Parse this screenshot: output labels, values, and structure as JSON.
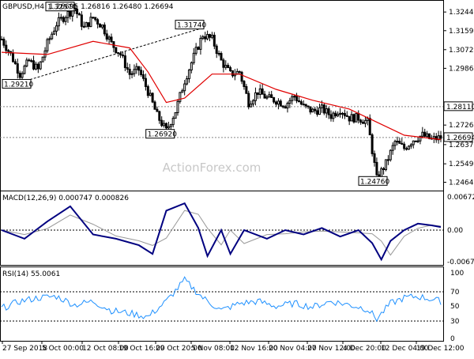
{
  "header": {
    "symbol": "GBPUSD,H4",
    "ohlc": "1.26695 1.26816 1.26480 1.26694"
  },
  "watermark": "ActionForex.com",
  "price_pane": {
    "y_ticks": [
      "1.32445",
      "1.31590",
      "1.30720",
      "1.29865",
      "1.28110",
      "1.27265",
      "1.26370",
      "1.25490",
      "1.24645"
    ],
    "current_price": "1.26694",
    "resistance_level": "1.28110",
    "swing_labels": [
      {
        "text": "1.32570",
        "price": 1.3257,
        "x_label": "5 Oct 00:00"
      },
      {
        "text": "1.31740",
        "price": 1.3174,
        "x_label": "5 Nov 08:00"
      },
      {
        "text": "1.29210",
        "price": 1.2921,
        "x_label": "27 Sep 2018"
      },
      {
        "text": "1.26920",
        "price": 1.2692,
        "x_label": "29 Oct 20:00"
      },
      {
        "text": "1.24760",
        "price": 1.2476,
        "x_label": "4 Dec 20:00"
      }
    ]
  },
  "macd_pane": {
    "label": "MACD(12,26,9) 0.000747 0.000826",
    "y_ticks": [
      "0.006729",
      "0.00",
      "-0.006758"
    ]
  },
  "rsi_pane": {
    "label": "RSI(14) 55.0061",
    "y_ticks": [
      "100",
      "70",
      "50",
      "30",
      "0"
    ]
  },
  "x_ticks": [
    "27 Sep 2018",
    "5 Oct 00:00",
    "12 Oct 08:00",
    "19 Oct 16:00",
    "29 Oct 20:00",
    "5 Nov 08:00",
    "12 Nov 16:00",
    "20 Nov 04:00",
    "27 Nov 12:00",
    "4 Dec 20:00",
    "12 Dec 04:00",
    "19 Dec 12:00"
  ],
  "chart_data": {
    "type": "candlestick",
    "symbol": "GBPUSD",
    "timeframe": "H4",
    "y_range": [
      1.243,
      1.3285
    ],
    "moving_average_color": "#e00000",
    "close_path": [
      [
        0,
        1.312
      ],
      [
        4,
        1.305
      ],
      [
        8,
        1.296
      ],
      [
        12,
        1.302
      ],
      [
        16,
        1.298
      ],
      [
        20,
        1.31
      ],
      [
        24,
        1.319
      ],
      [
        28,
        1.323
      ],
      [
        32,
        1.326
      ],
      [
        36,
        1.317
      ],
      [
        40,
        1.322
      ],
      [
        44,
        1.318
      ],
      [
        48,
        1.31
      ],
      [
        52,
        1.305
      ],
      [
        56,
        1.296
      ],
      [
        60,
        1.298
      ],
      [
        64,
        1.288
      ],
      [
        68,
        1.277
      ],
      [
        72,
        1.27
      ],
      [
        76,
        1.279
      ],
      [
        80,
        1.293
      ],
      [
        84,
        1.304
      ],
      [
        88,
        1.314
      ],
      [
        92,
        1.312
      ],
      [
        96,
        1.302
      ],
      [
        100,
        1.296
      ],
      [
        104,
        1.297
      ],
      [
        108,
        1.283
      ],
      [
        112,
        1.288
      ],
      [
        116,
        1.285
      ],
      [
        120,
        1.284
      ],
      [
        124,
        1.282
      ],
      [
        128,
        1.286
      ],
      [
        132,
        1.281
      ],
      [
        136,
        1.279
      ],
      [
        140,
        1.28
      ],
      [
        144,
        1.277
      ],
      [
        148,
        1.28
      ],
      [
        152,
        1.276
      ],
      [
        156,
        1.276
      ],
      [
        160,
        1.274
      ],
      [
        164,
        1.248
      ],
      [
        168,
        1.255
      ],
      [
        172,
        1.265
      ],
      [
        176,
        1.262
      ],
      [
        180,
        1.266
      ],
      [
        184,
        1.268
      ],
      [
        188,
        1.266
      ],
      [
        192,
        1.267
      ]
    ],
    "ma_path": [
      [
        0,
        1.306
      ],
      [
        20,
        1.305
      ],
      [
        40,
        1.311
      ],
      [
        56,
        1.308
      ],
      [
        64,
        1.297
      ],
      [
        72,
        1.283
      ],
      [
        80,
        1.285
      ],
      [
        92,
        1.296
      ],
      [
        104,
        1.296
      ],
      [
        120,
        1.289
      ],
      [
        136,
        1.284
      ],
      [
        152,
        1.28
      ],
      [
        164,
        1.274
      ],
      [
        176,
        1.268
      ],
      [
        192,
        1.266
      ]
    ],
    "macd_path": [
      [
        0,
        0.0
      ],
      [
        10,
        -0.002
      ],
      [
        20,
        0.002
      ],
      [
        30,
        0.0055
      ],
      [
        40,
        -0.001
      ],
      [
        50,
        -0.002
      ],
      [
        60,
        -0.0035
      ],
      [
        66,
        -0.0055
      ],
      [
        72,
        0.0045
      ],
      [
        80,
        0.0062
      ],
      [
        86,
        0.0005
      ],
      [
        90,
        -0.006
      ],
      [
        96,
        0.0
      ],
      [
        100,
        -0.0055
      ],
      [
        106,
        0.0
      ],
      [
        116,
        -0.002
      ],
      [
        124,
        0.0
      ],
      [
        132,
        -0.001
      ],
      [
        140,
        0.0005
      ],
      [
        148,
        -0.0015
      ],
      [
        156,
        0.0
      ],
      [
        162,
        -0.003
      ],
      [
        166,
        -0.0068
      ],
      [
        170,
        -0.0025
      ],
      [
        176,
        0.0
      ],
      [
        182,
        0.0015
      ],
      [
        188,
        0.0011
      ],
      [
        192,
        0.0007
      ]
    ],
    "rsi_path": [
      [
        0,
        45
      ],
      [
        8,
        55
      ],
      [
        16,
        60
      ],
      [
        24,
        62
      ],
      [
        32,
        50
      ],
      [
        40,
        55
      ],
      [
        48,
        42
      ],
      [
        56,
        38
      ],
      [
        64,
        33
      ],
      [
        72,
        55
      ],
      [
        80,
        85
      ],
      [
        88,
        60
      ],
      [
        96,
        42
      ],
      [
        104,
        52
      ],
      [
        112,
        55
      ],
      [
        120,
        48
      ],
      [
        128,
        52
      ],
      [
        136,
        47
      ],
      [
        144,
        55
      ],
      [
        152,
        50
      ],
      [
        160,
        44
      ],
      [
        164,
        30
      ],
      [
        170,
        52
      ],
      [
        176,
        60
      ],
      [
        182,
        62
      ],
      [
        188,
        58
      ],
      [
        192,
        55
      ]
    ]
  }
}
